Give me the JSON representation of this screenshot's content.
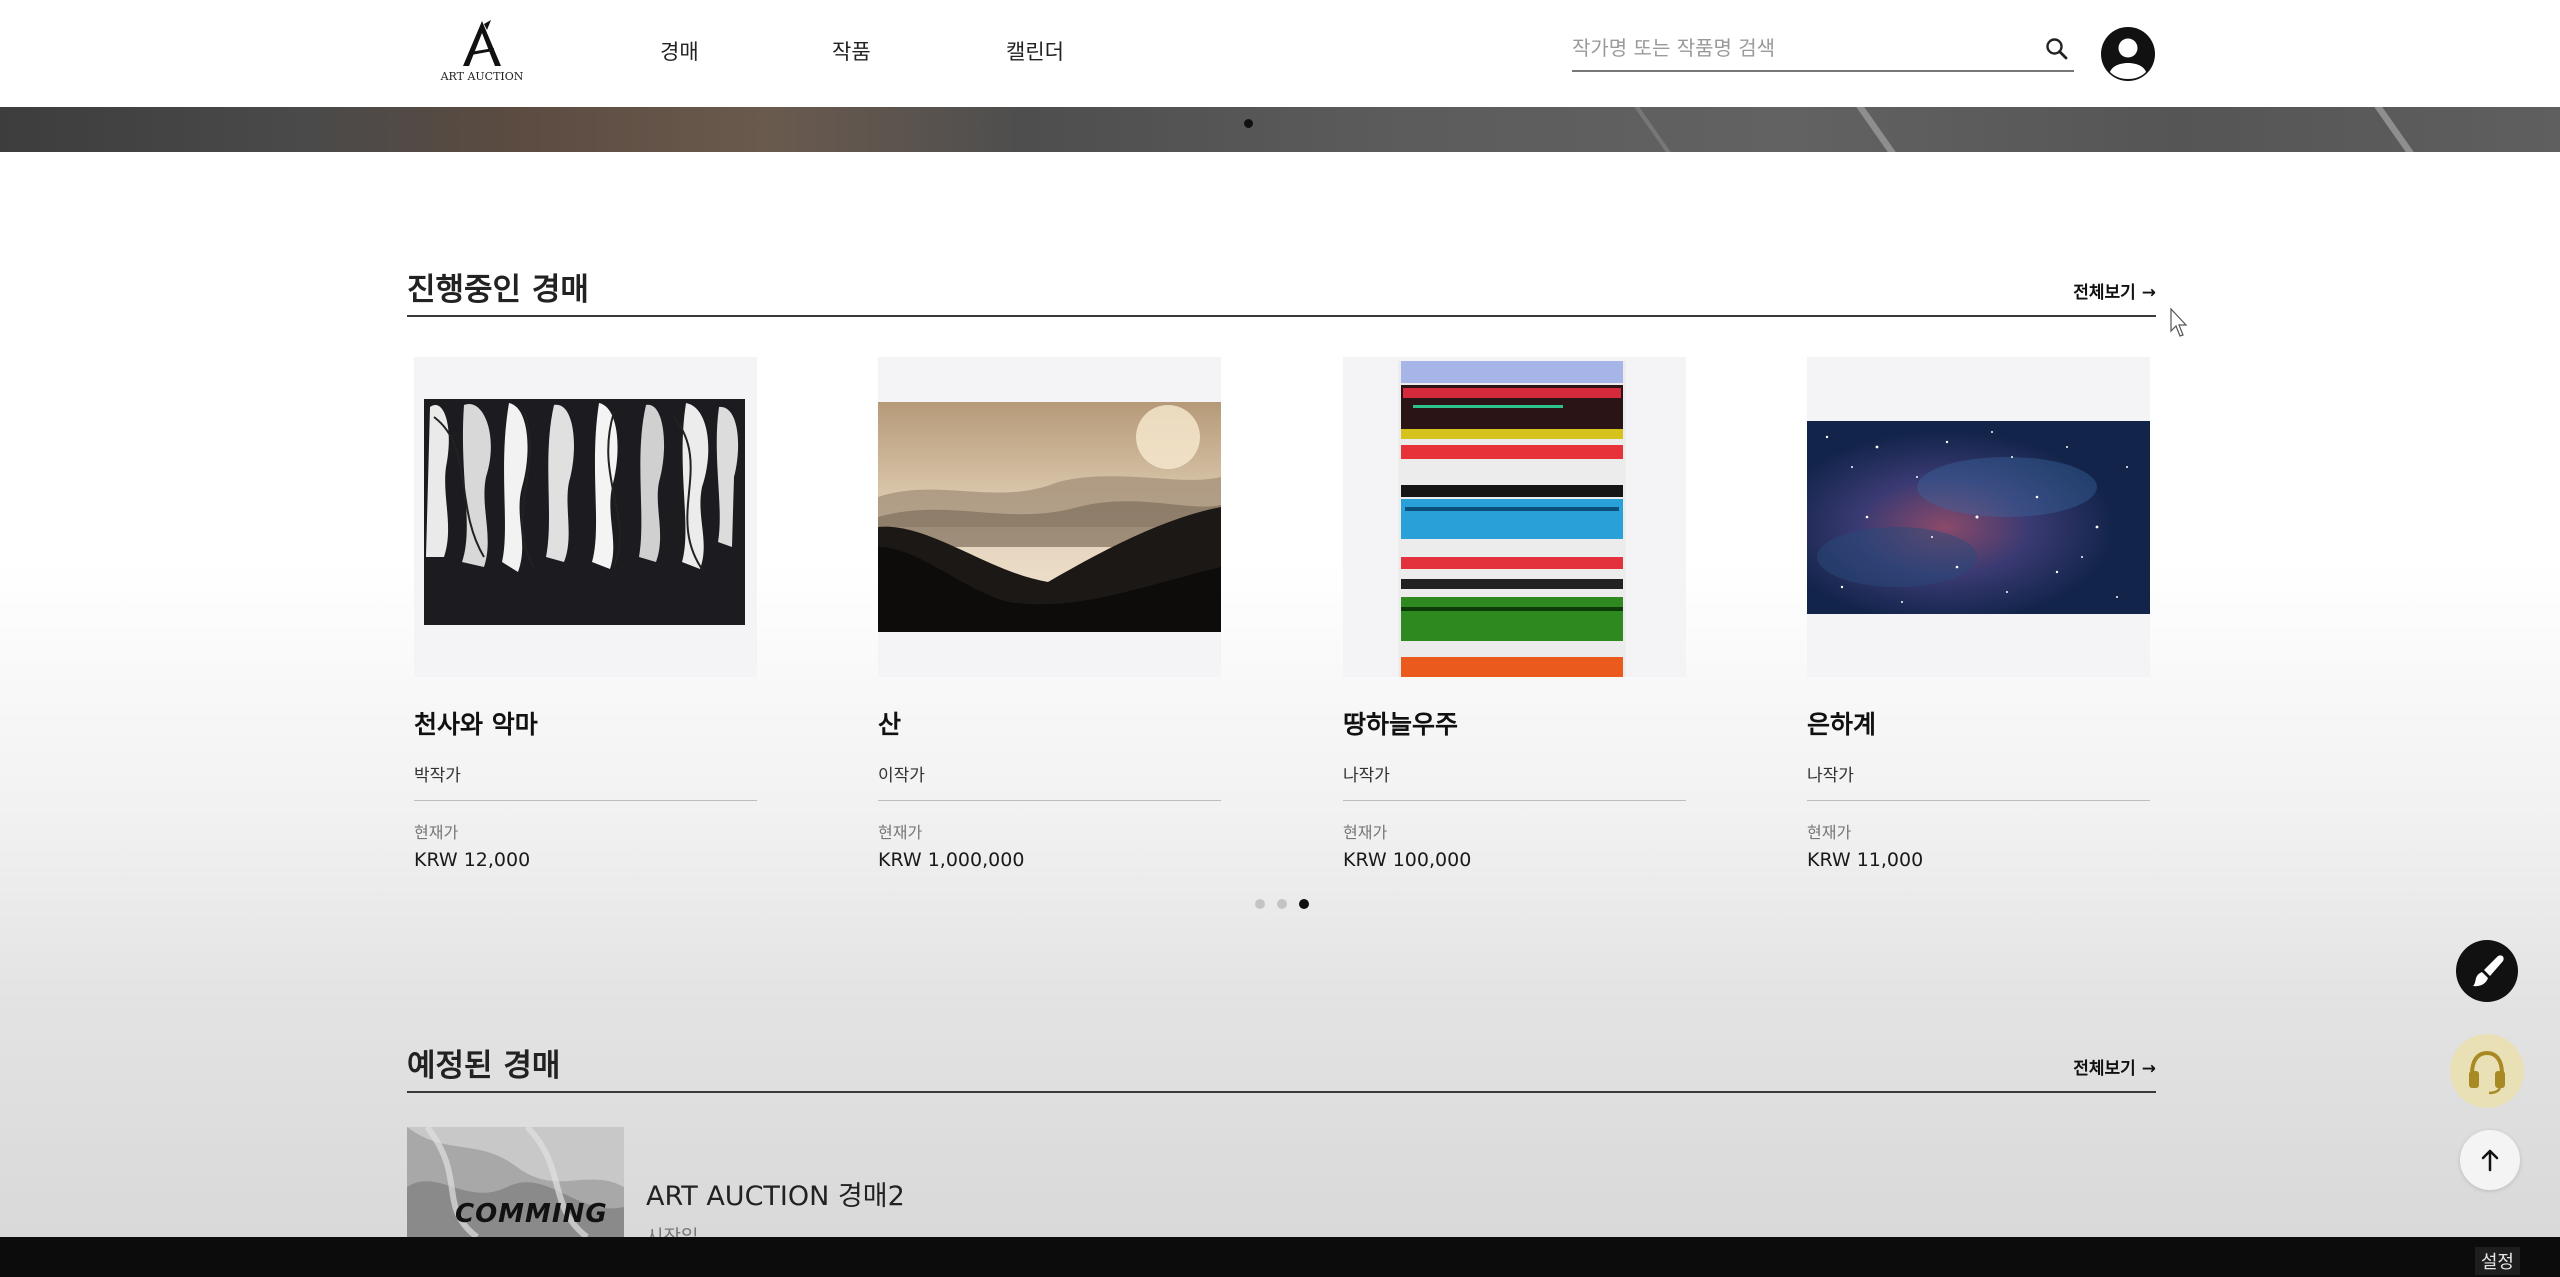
{
  "header": {
    "logo_text": "ART AUCTION",
    "nav": [
      "경매",
      "작품",
      "캘린더"
    ],
    "search_placeholder": "작가명 또는 작품명 검색"
  },
  "ongoing": {
    "title": "진행중인 경매",
    "view_all": "전체보기 →",
    "cards": [
      {
        "title": "천사와 악마",
        "artist": "박작가",
        "price_label": "현재가",
        "price": "KRW 12,000"
      },
      {
        "title": "산",
        "artist": "이작가",
        "price_label": "현재가",
        "price": "KRW 1,000,000"
      },
      {
        "title": "땅하늘우주",
        "artist": "나작가",
        "price_label": "현재가",
        "price": "KRW 100,000"
      },
      {
        "title": "은하계",
        "artist": "나작가",
        "price_label": "현재가",
        "price": "KRW 11,000"
      }
    ],
    "carousel": {
      "pages": 3,
      "active_page": 3
    }
  },
  "upcoming": {
    "title": "예정된 경매",
    "view_all": "전체보기 →",
    "item": {
      "thumb_label": "COMMING",
      "title": "ART AUCTION 경매2",
      "subtitle": "시작일"
    }
  },
  "footer": {
    "settings_label": "설정"
  },
  "colors": {
    "support_button": "#e9e0b6",
    "support_icon": "#a88a25",
    "dark": "#111111"
  }
}
